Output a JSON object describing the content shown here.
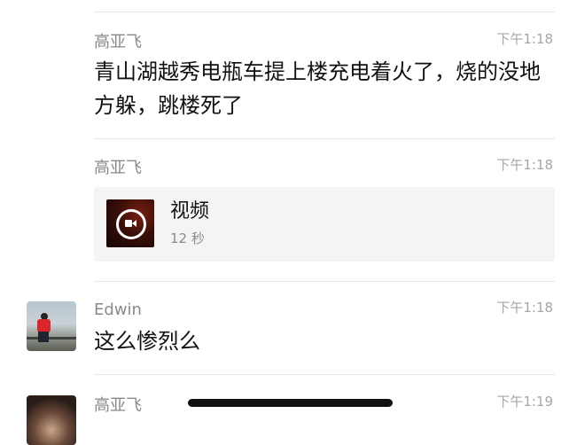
{
  "messages": [
    {
      "sender": "高亚飞",
      "time": "下午1:18",
      "text": "青山湖越秀电瓶车提上楼充电着火了，烧的没地方躲，跳楼死了"
    },
    {
      "sender": "高亚飞",
      "time": "下午1:18",
      "video": {
        "title": "视频",
        "duration": "12 秒",
        "icon": "video-camera-icon"
      }
    },
    {
      "sender": "Edwin",
      "time": "下午1:18",
      "text": "这么惨烈么"
    },
    {
      "sender": "高亚飞",
      "time": "下午1:19"
    }
  ],
  "colors": {
    "background": "#ffffff",
    "divider": "#e6e6e6",
    "sender": "#8a8a8a",
    "time": "#a6a6a6",
    "card": "#f4f4f4",
    "text": "#111111"
  }
}
